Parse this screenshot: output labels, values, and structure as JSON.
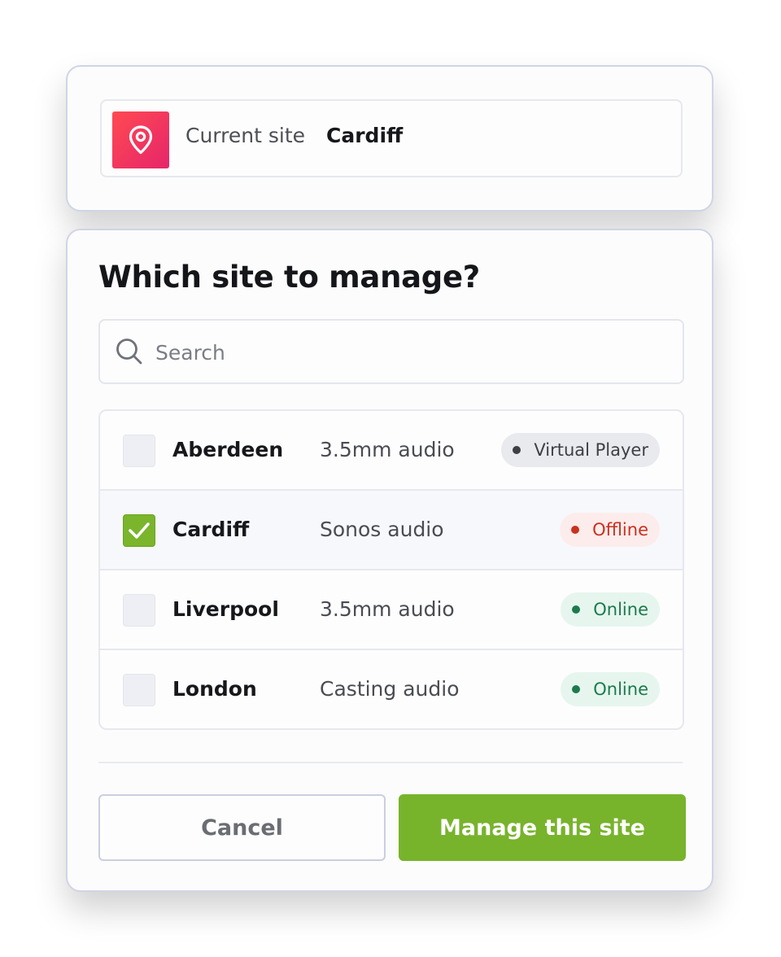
{
  "current_site": {
    "label": "Current site",
    "value": "Cardiff",
    "icon": "map-pin-icon"
  },
  "dialog": {
    "title": "Which site to manage?",
    "search": {
      "placeholder": "Search",
      "value": "",
      "icon": "search-icon"
    },
    "sites": [
      {
        "name": "Aberdeen",
        "audio": "3.5mm audio",
        "status": "Virtual Player",
        "checked": false
      },
      {
        "name": "Cardiff",
        "audio": "Sonos audio",
        "status": "Offline",
        "checked": true
      },
      {
        "name": "Liverpool",
        "audio": "3.5mm audio",
        "status": "Online",
        "checked": false
      },
      {
        "name": "London",
        "audio": "Casting audio",
        "status": "Online",
        "checked": false
      }
    ],
    "cancel_label": "Cancel",
    "manage_label": "Manage this site"
  },
  "colors": {
    "accent_green": "#78b32c",
    "pin_gradient_start": "#ff4a52",
    "pin_gradient_end": "#e6256b",
    "status_offline": "#c8321f",
    "status_online": "#1c7a4d",
    "status_virtual": "#3d3f45"
  }
}
